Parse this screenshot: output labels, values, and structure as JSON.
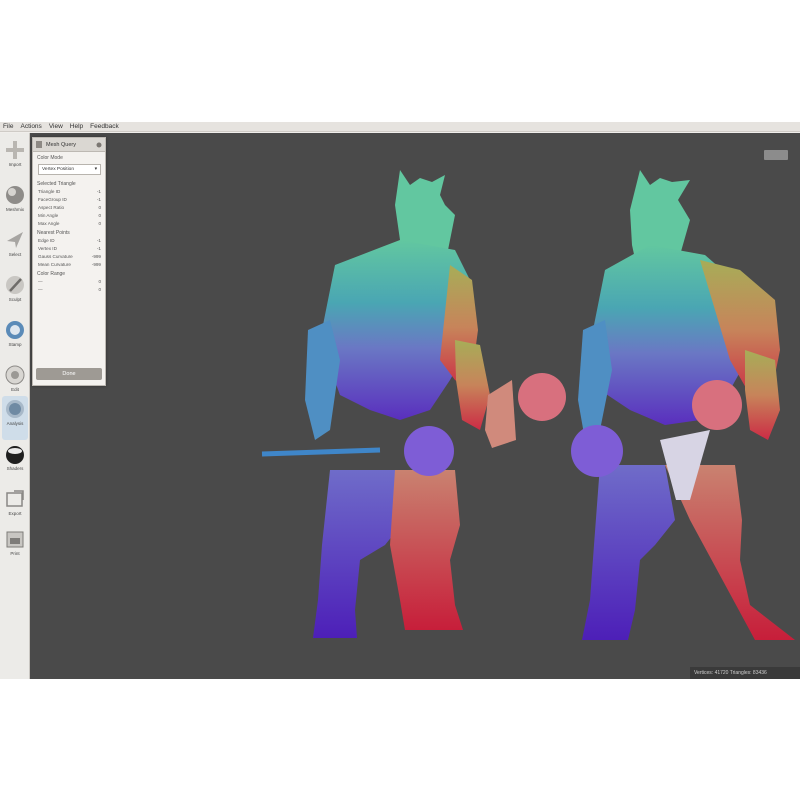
{
  "menu": [
    "File",
    "Actions",
    "View",
    "Help",
    "Feedback"
  ],
  "toolbar": [
    {
      "label": "Import",
      "icon": "plus-icon"
    },
    {
      "label": "Meshmix",
      "icon": "sphere-icon"
    },
    {
      "label": "Select",
      "icon": "arrow-icon"
    },
    {
      "label": "Sculpt",
      "icon": "brush-icon"
    },
    {
      "label": "Stamp",
      "icon": "stamp-icon"
    },
    {
      "label": "Edit",
      "icon": "edit-icon"
    },
    {
      "label": "Analysis",
      "icon": "analysis-icon"
    },
    {
      "label": "Shaders",
      "icon": "shader-ball-icon"
    },
    {
      "label": "Export",
      "icon": "export-icon"
    },
    {
      "label": "Print",
      "icon": "print-icon"
    }
  ],
  "panel": {
    "title": "Mesh Query",
    "color_mode_label": "Color Mode",
    "color_mode_value": "Vertex Position",
    "selected_triangle_header": "Selected Triangle",
    "triangle_rows": [
      {
        "label": "Triangle ID",
        "value": "-1"
      },
      {
        "label": "FaceGroup ID",
        "value": "-1"
      },
      {
        "label": "Aspect Ratio",
        "value": "0"
      },
      {
        "label": "Min Angle",
        "value": "0"
      },
      {
        "label": "Max Angle",
        "value": "0"
      }
    ],
    "nearest_points_header": "Nearest Points",
    "point_rows": [
      {
        "label": "Edge ID",
        "value": "-1"
      },
      {
        "label": "Vertex ID",
        "value": "-1"
      },
      {
        "label": "Gauss Curvature",
        "value": "-999"
      },
      {
        "label": "Mean Curvature",
        "value": "-999"
      }
    ],
    "color_range_header": "Color Range",
    "range_rows": [
      {
        "label": "—",
        "value": "0"
      },
      {
        "label": "—",
        "value": "0"
      }
    ],
    "done_label": "Done"
  },
  "status": "Vertices: 41720 Triangles: 83436"
}
